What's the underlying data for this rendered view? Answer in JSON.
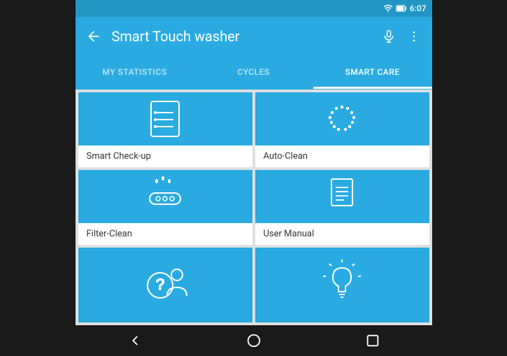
{
  "statusBar": {
    "time": "6:07",
    "wifiIcon": "wifi",
    "batteryIcon": "battery"
  },
  "topBar": {
    "backIcon": "back-arrow",
    "title": "Smart Touch washer",
    "micIcon": "microphone",
    "moreIcon": "more-vertical"
  },
  "tabs": [
    {
      "id": "my-statistics",
      "label": "MY STATISTICS",
      "active": false
    },
    {
      "id": "cycles",
      "label": "CYCLES",
      "active": false
    },
    {
      "id": "smart-care",
      "label": "SMART CARE",
      "active": true
    }
  ],
  "gridItems": [
    {
      "id": "smart-checkup",
      "label": "Smart Check-up",
      "icon": "checkup"
    },
    {
      "id": "auto-clean",
      "label": "Auto-Clean",
      "icon": "auto-clean"
    },
    {
      "id": "filter-clean",
      "label": "Filter-Clean",
      "icon": "filter-clean"
    },
    {
      "id": "user-manual",
      "label": "User Manual",
      "icon": "user-manual"
    },
    {
      "id": "help",
      "label": "",
      "icon": "help"
    },
    {
      "id": "tips",
      "label": "",
      "icon": "tips"
    }
  ],
  "bottomNav": {
    "backIcon": "back-triangle",
    "homeIcon": "home-circle",
    "recentIcon": "recent-square"
  }
}
